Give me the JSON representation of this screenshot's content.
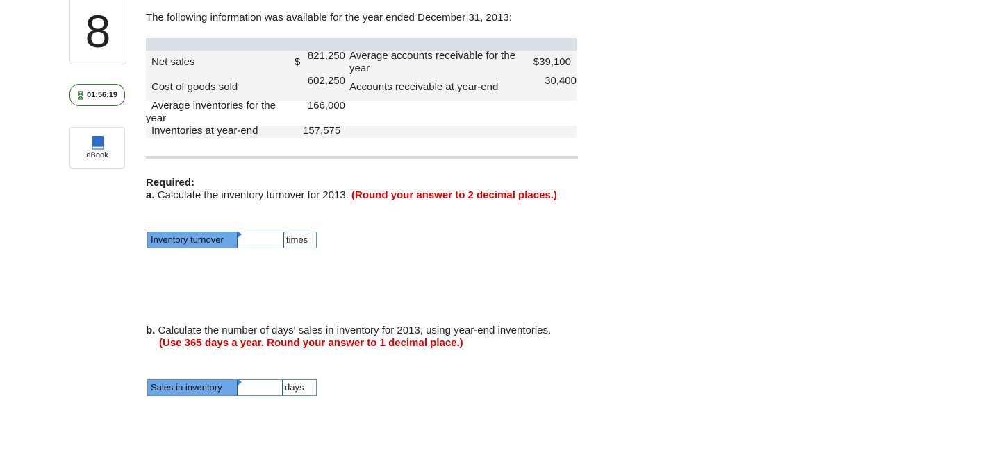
{
  "question": {
    "number": "8"
  },
  "timer": {
    "time": "01:56:19",
    "icon": "hourglass-icon"
  },
  "ebook": {
    "label": "eBook",
    "icon": "book-icon"
  },
  "intro": "The following information was available for the year ended December 31, 2013:",
  "table": {
    "currency": "$",
    "net_sales_label": "Net sales",
    "net_sales_value": "821,250",
    "cogs_label": "Cost of goods sold",
    "cogs_value": "602,250",
    "avg_inv_label_1": "Average inventories for the",
    "avg_inv_label_2": "year",
    "avg_inv_value": "166,000",
    "inv_end_label": "Inventories at year-end",
    "inv_end_value": "157,575",
    "avg_ar_label_1": "Average accounts receivable for the",
    "avg_ar_label_2": "year",
    "avg_ar_value": "$39,100",
    "ar_end_label": "Accounts receivable at year-end",
    "ar_end_value": "30,400"
  },
  "required": {
    "heading": "Required:",
    "a_prefix": "a.",
    "a_text": "Calculate the inventory turnover for 2013.",
    "a_note": "(Round your answer to 2 decimal places.)",
    "b_prefix": "b.",
    "b_text": "Calculate the number of days' sales in inventory for 2013, using year-end inventories.",
    "b_note": "(Use 365 days a year. Round your answer to 1 decimal place.)"
  },
  "answer_a": {
    "label": "Inventory turnover",
    "value": "",
    "unit": "times"
  },
  "answer_b": {
    "label": "Sales in inventory",
    "value": "",
    "unit": "days"
  },
  "colors": {
    "accent_blue": "#6aa6e8",
    "note_red": "#e00000",
    "timer_green": "#2e7d32"
  }
}
